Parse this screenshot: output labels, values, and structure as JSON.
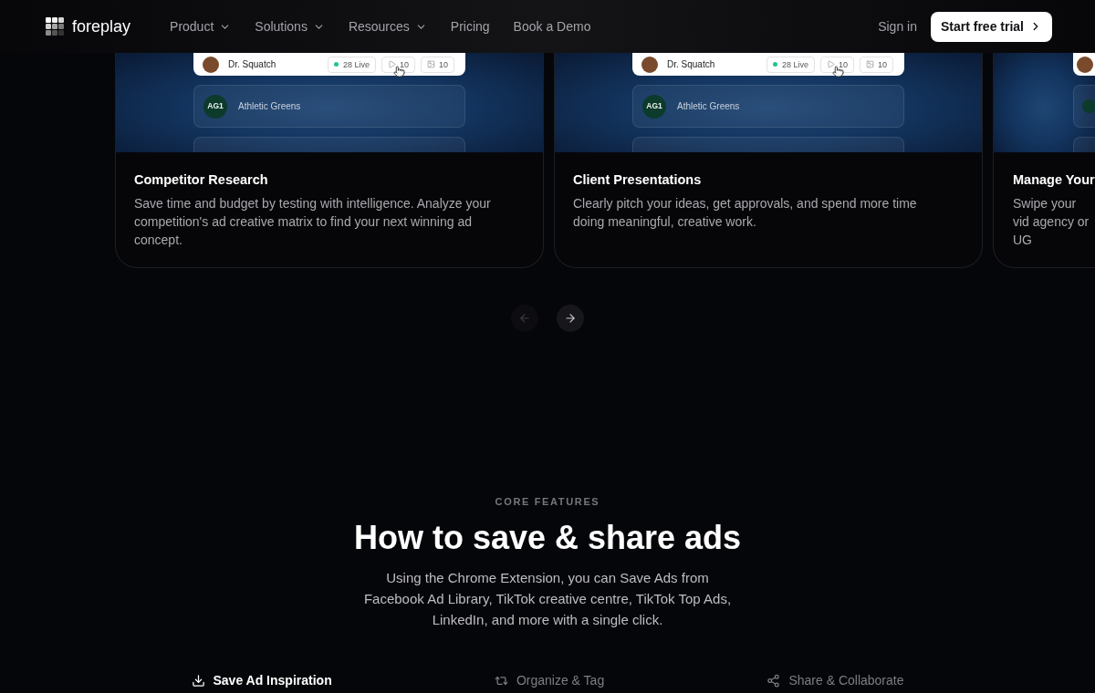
{
  "nav": {
    "brand": "foreplay",
    "links": [
      {
        "label": "Product",
        "dropdown": true
      },
      {
        "label": "Solutions",
        "dropdown": true
      },
      {
        "label": "Resources",
        "dropdown": true
      },
      {
        "label": "Pricing",
        "dropdown": false
      },
      {
        "label": "Book a Demo",
        "dropdown": false
      }
    ],
    "sign_in": "Sign in",
    "cta": "Start free trial"
  },
  "cards": [
    {
      "kind": "full",
      "preview": {
        "featured_row": {
          "name": "Dr. Squatch",
          "live": "28 Live",
          "videos": "10",
          "images": "10"
        },
        "list_row": {
          "logo": "AG1",
          "name": "Athletic Greens"
        }
      },
      "title": "Competitor Research",
      "description": "Save time and budget by testing with intelligence. Analyze your competition's ad creative matrix to find your next winning ad concept."
    },
    {
      "kind": "full",
      "preview": {
        "featured_row": {
          "name": "Dr. Squatch",
          "live": "28 Live",
          "videos": "10",
          "images": "10"
        },
        "list_row": {
          "logo": "AG1",
          "name": "Athletic Greens"
        }
      },
      "title": "Client Presentations",
      "description": "Clearly pitch your ideas, get approvals, and spend more time doing meaningful, creative work."
    },
    {
      "kind": "partial",
      "title": "Manage Your",
      "description": "Swipe your vid agency or UG"
    }
  ],
  "carousel": [
    {
      "kind": "prev",
      "disabled": true
    },
    {
      "kind": "next",
      "disabled": false
    }
  ],
  "features": {
    "eyebrow": "CORE FEATURES",
    "heading": "How to save & share ads",
    "intro": "Using the Chrome Extension, you can Save Ads from Facebook Ad Library, TikTok creative centre, TikTok Top Ads, LinkedIn, and more with a single click.",
    "tabs": [
      {
        "kind": "save",
        "label": "Save Ad Inspiration",
        "selected": true
      },
      {
        "kind": "organize",
        "label": "Organize & Tag",
        "selected": false
      },
      {
        "kind": "share",
        "label": "Share & Collaborate",
        "selected": false
      }
    ]
  }
}
